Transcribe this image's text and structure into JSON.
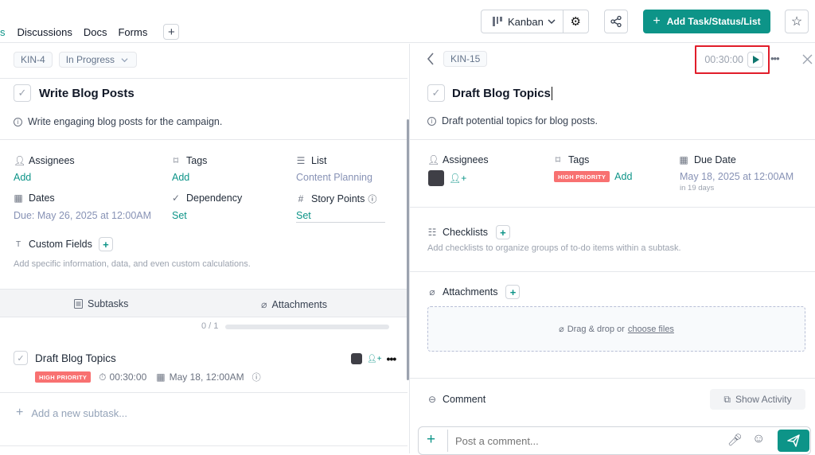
{
  "topbar": {
    "cut_tab": "s",
    "tabs": [
      "Discussions",
      "Docs",
      "Forms"
    ],
    "add_tab": "+",
    "view_label": "Kanban",
    "add_task_label": "Add Task/Status/List"
  },
  "left": {
    "task_id": "KIN-4",
    "status": "In Progress",
    "title": "Write Blog Posts",
    "description": "Write engaging blog posts for the campaign.",
    "assignees_label": "Assignees",
    "assignees_value": "Add",
    "tags_label": "Tags",
    "tags_value": "Add",
    "list_label": "List",
    "list_value": "Content Planning",
    "dates_label": "Dates",
    "dates_value": "Due: May 26, 2025 at 12:00AM",
    "dependency_label": "Dependency",
    "dependency_value": "Set",
    "story_points_label": "Story Points",
    "story_points_value": "Set",
    "custom_fields_label": "Custom Fields",
    "custom_fields_hint": "Add specific information, data, and even custom calculations.",
    "subtabs": {
      "subtasks": "Subtasks",
      "attachments": "Attachments"
    },
    "progress": {
      "label": "0 / 1",
      "fraction": 0
    },
    "subtask": {
      "title": "Draft Blog Topics",
      "priority": "HIGH PRIORITY",
      "time": "00:30:00",
      "date": "May 18, 12:00AM"
    },
    "add_subtask": "Add a new subtask..."
  },
  "right": {
    "task_id": "KIN-15",
    "timer": "00:30:00",
    "title": "Draft Blog Topics",
    "description": "Draft potential topics for blog posts.",
    "assignees_label": "Assignees",
    "tags_label": "Tags",
    "priority": "HIGH PRIORITY",
    "tags_add": "Add",
    "due_label": "Due Date",
    "due_value": "May 18, 2025 at 12:00AM",
    "due_relative": "in 19 days",
    "checklists_label": "Checklists",
    "checklists_hint": "Add checklists to organize groups of to-do items within a subtask.",
    "attachments_label": "Attachments",
    "drop_text": "Drag & drop or",
    "drop_link": "choose files",
    "comment_label": "Comment",
    "show_activity": "Show Activity",
    "comment_placeholder": "Post a comment..."
  },
  "colors": {
    "accent": "#0d9488",
    "priority": "#f87171",
    "highlight": "#e11d2a"
  },
  "icons": [
    "kanban-icon",
    "gear-icon",
    "share-icon",
    "plus-icon",
    "star-icon",
    "chevron-left-icon",
    "play-icon",
    "more-icon",
    "close-icon",
    "user-icon",
    "tag-icon",
    "list-icon",
    "calendar-icon",
    "check-icon",
    "hash-icon",
    "help-icon",
    "custom-fields-icon",
    "subtasks-icon",
    "paperclip-icon",
    "stopwatch-icon",
    "info-icon",
    "add-user-icon",
    "checklist-icon",
    "comment-icon",
    "activity-icon",
    "mic-icon",
    "emoji-icon",
    "send-icon"
  ]
}
